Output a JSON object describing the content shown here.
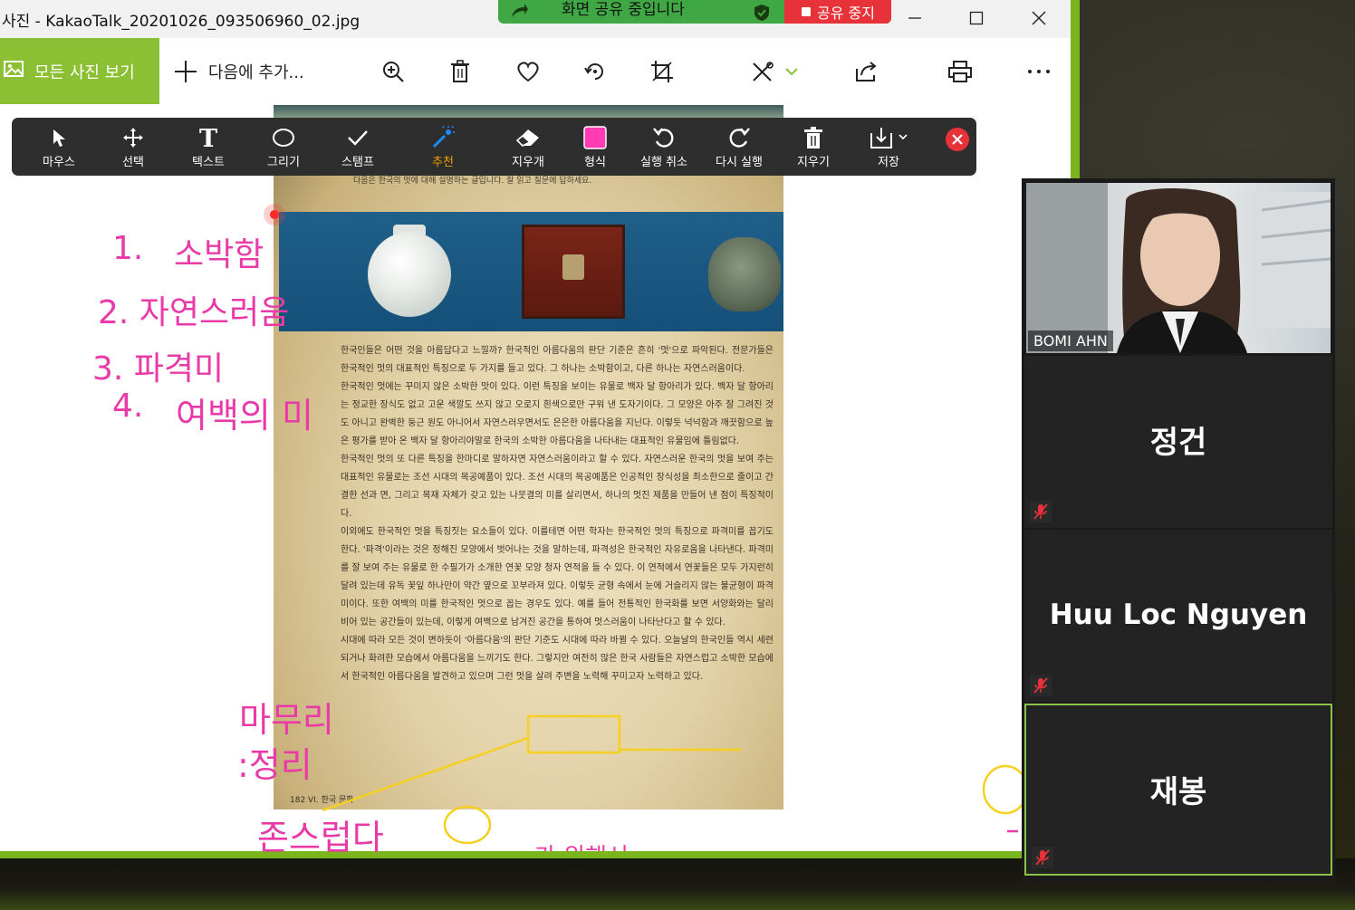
{
  "window": {
    "title": "사진 - KakaoTalk_20201026_093506960_02.jpg",
    "minimize": "—",
    "maximize": "☐",
    "close": "✕"
  },
  "share_banner": {
    "text": "화면 공유 중입니다",
    "stop_label": "공유 중지"
  },
  "toolbar": {
    "view_all_label": "모든 사진 보기",
    "add_to_label": "다음에 추가...",
    "icons": [
      "zoom-in-icon",
      "trash-icon",
      "heart-icon",
      "rotate-icon",
      "crop-icon",
      "edit-icon",
      "share-icon",
      "print-icon",
      "more-icon"
    ]
  },
  "annotate": {
    "items": [
      {
        "label": "마우스",
        "icon": "cursor-icon"
      },
      {
        "label": "선택",
        "icon": "move-icon"
      },
      {
        "label": "텍스트",
        "icon": "text-icon"
      },
      {
        "label": "그리기",
        "icon": "draw-icon"
      },
      {
        "label": "스탬프",
        "icon": "stamp-icon"
      },
      {
        "label": "추천",
        "icon": "spotlight-icon"
      },
      {
        "label": "지우개",
        "icon": "eraser-icon"
      },
      {
        "label": "형식",
        "icon": "format-icon"
      },
      {
        "label": "실행 취소",
        "icon": "undo-icon"
      },
      {
        "label": "다시 실행",
        "icon": "redo-icon"
      },
      {
        "label": "지우기",
        "icon": "clear-icon"
      },
      {
        "label": "저장",
        "icon": "save-icon"
      }
    ],
    "active_index": 5,
    "accent_color": "#f0a000",
    "format_color": "#ff3cb4"
  },
  "photo": {
    "caption": "다음은 한국의 멋에 대해 설명하는 글입니다. 잘 읽고 질문에 답하세요.",
    "body": "한국인들은 어떤 것을 아름답다고 느낄까? 한국적인 아름다움의 판단 기준은 흔히 '멋'으로 파악된다. 전문가들은 한국적인 멋의 대표적인 특징으로 두 가지를 들고 있다. 그 하나는 소박함이고, 다른 하나는 자연스러움이다.\n한국적인 멋에는 꾸미지 않은 소박한 맛이 있다. 이런 특징을 보이는 유물로 백자 달 항아리가 있다. 백자 달 항아리는 정교한 장식도 없고 고운 색깔도 쓰지 않고 오로지 흰색으로만 구워 낸 도자기이다. 그 모양은 아주 잘 그려진 것도 아니고 완벽한 둥근 원도 아니어서 자연스러우면서도 은은한 아름다움을 지닌다. 이렇듯 넉넉함과 깨끗함으로 높은 평가를 받아 온 백자 달 항아리야말로 한국의 소박한 아름다움을 나타내는 대표적인 유물임에 틀림없다.\n한국적인 멋의 또 다른 특징을 한마디로 말하자면 자연스러움이라고 할 수 있다. 자연스러운 한국의 멋을 보여 주는 대표적인 유물로는 조선 시대의 목공예품이 있다. 조선 시대의 목공예품은 인공적인 장식성을 최소한으로 줄이고 간결한 선과 면, 그리고 목재 자체가 갖고 있는 나뭇결의 미를 살리면서, 하나의 멋진 제품을 만들어 낸 점이 특징적이다.\n이외에도 한국적인 멋을 특징짓는 요소들이 있다. 이를테면 어떤 학자는 한국적인 멋의 특징으로 파격미를 꼽기도 한다. '파격'이라는 것은 정해진 모양에서 벗어나는 것을 말하는데, 파격성은 한국적인 자유로움을 나타낸다. 파격미를 잘 보여 주는 유물로 한 수필가가 소개한 연꽃 모양 청자 연적을 들 수 있다. 이 연적에서 연꽃들은 모두 가지런히 달려 있는데 유독 꽃잎 하나만이 약간 옆으로 꼬부라져 있다. 이렇듯 균형 속에서 눈에 거슬리지 않는 불균형이 파격미이다. 또한 여백의 미를 한국적인 멋으로 꼽는 경우도 있다. 예를 들어 전통적인 한국화를 보면 서양화와는 달리 비어 있는 공간들이 있는데, 이렇게 여백으로 남겨진 공간을 통하여 멋스러움이 나타난다고 할 수 있다.\n시대에 따라 모든 것이 변하듯이 '아름다움'의 판단 기준도 시대에 따라 바뀔 수 있다. 오늘날의 한국인들 역시 세련되거나 화려한 모습에서 아름다움을 느끼기도 한다. 그렇지만 여전히 많은 한국 사람들은 자연스럽고 소박한 모습에서 한국적인 아름다움을 발견하고 있으며 그런 멋을 살려 주변을 노력해 꾸미고자 노력하고 있다.",
    "page": "182   VI. 한국 문화"
  },
  "annotations": {
    "items": [
      "1.",
      "소박함",
      "2. 자연스러움",
      "3. 파격미",
      "4.",
      "여백의 미",
      "마무리",
      ":정리",
      "존스럽다",
      "가 위해서"
    ],
    "color": "#e93aa8",
    "highlight_color": "#f5d020"
  },
  "participants": {
    "video": {
      "name": "BOMI AHN"
    },
    "tiles": [
      {
        "name": "정건",
        "muted": true
      },
      {
        "name": "Huu Loc Nguyen",
        "muted": true
      },
      {
        "name": "재봉",
        "muted": true,
        "active_speaker": true
      }
    ],
    "active_border_color": "#8bc34a"
  }
}
